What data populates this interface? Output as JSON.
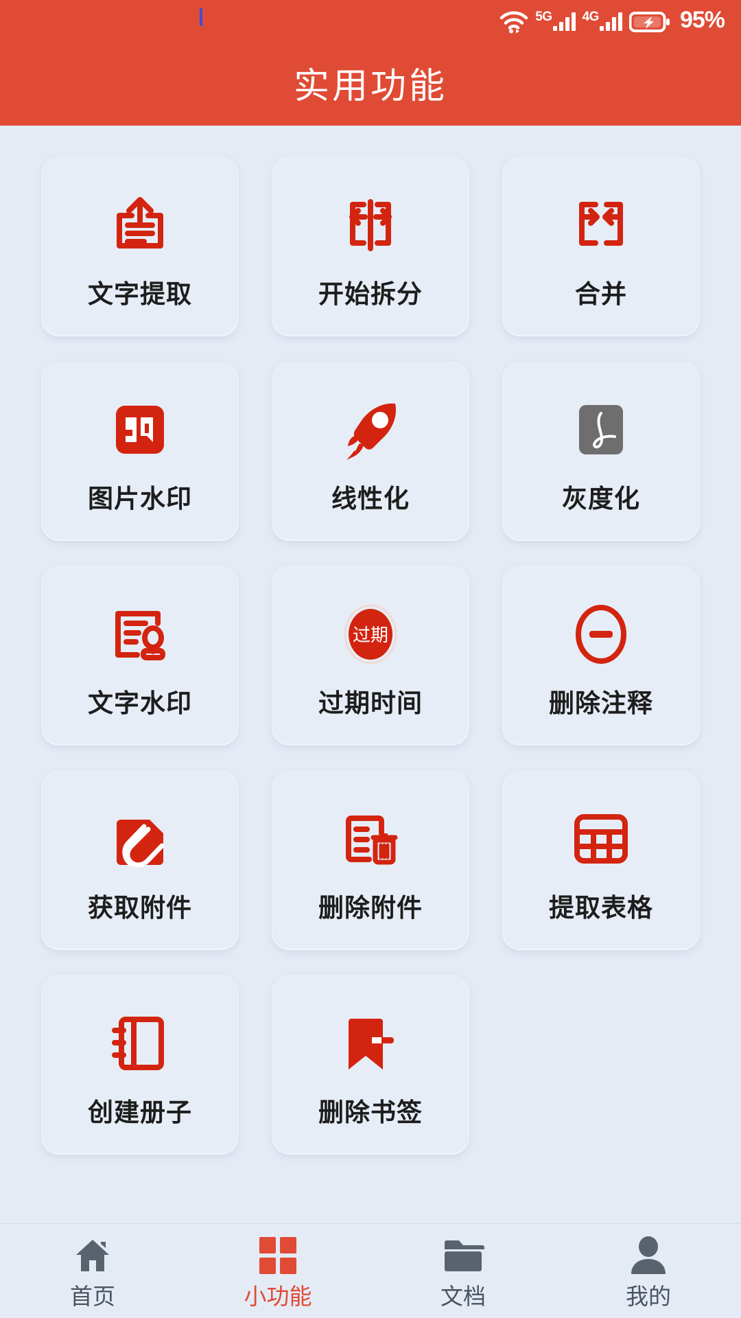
{
  "status_bar": {
    "wifi_icon": "wifi-icon",
    "network_1_label": "5G",
    "network_2_label": "4G",
    "battery_icon": "battery-charging-icon",
    "battery_percent": "95%"
  },
  "header": {
    "title": "实用功能",
    "background_color": "#E04B35"
  },
  "theme": {
    "accent_red": "#D32410",
    "header_red": "#E04B35",
    "page_background": "#E4EBF5",
    "card_background": "#E7EDF6",
    "gray_icon": "#6E6E6E"
  },
  "tools": [
    {
      "label": "文字提取",
      "icon": "document-upload-icon"
    },
    {
      "label": "开始拆分",
      "icon": "split-pages-icon"
    },
    {
      "label": "合并",
      "icon": "merge-pages-icon"
    },
    {
      "label": "图片水印",
      "icon": "seal-stamp-icon"
    },
    {
      "label": "线性化",
      "icon": "rocket-icon"
    },
    {
      "label": "灰度化",
      "icon": "pdf-grayscale-icon"
    },
    {
      "label": "文字水印",
      "icon": "document-stamp-icon"
    },
    {
      "label": "过期时间",
      "icon": "expiry-badge-icon"
    },
    {
      "label": "删除注释",
      "icon": "remove-circle-icon"
    },
    {
      "label": "获取附件",
      "icon": "paperclip-attachment-icon"
    },
    {
      "label": "删除附件",
      "icon": "document-trash-icon"
    },
    {
      "label": "提取表格",
      "icon": "table-grid-icon"
    },
    {
      "label": "创建册子",
      "icon": "booklet-icon"
    },
    {
      "label": "删除书签",
      "icon": "bookmark-remove-icon"
    }
  ],
  "expiry_badge_text": "过期",
  "seal_badge_text": "印",
  "bottom_nav": [
    {
      "label": "首页",
      "icon": "home-icon",
      "active": false
    },
    {
      "label": "小功能",
      "icon": "grid-apps-icon",
      "active": true
    },
    {
      "label": "文档",
      "icon": "folder-icon",
      "active": false
    },
    {
      "label": "我的",
      "icon": "person-icon",
      "active": false
    }
  ]
}
